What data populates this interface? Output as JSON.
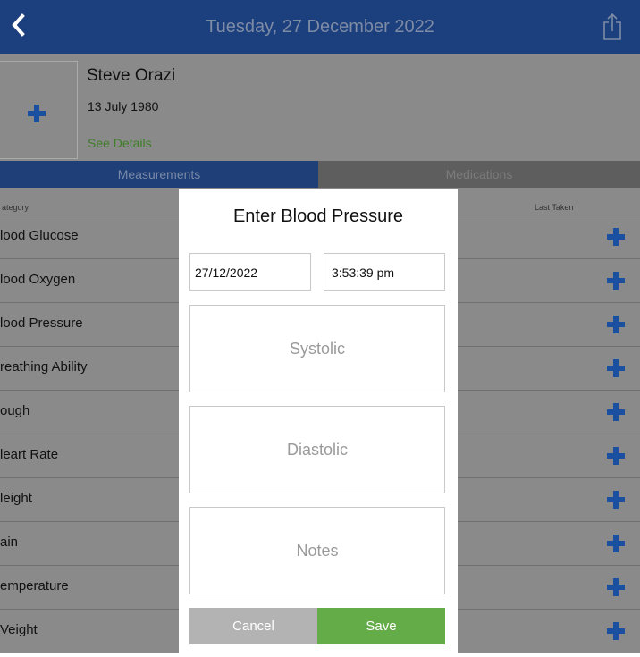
{
  "topbar": {
    "title": "Tuesday, 27 December 2022",
    "back_icon": "chevron-left-icon",
    "share_icon": "share-icon"
  },
  "patient": {
    "name": "Steve Orazi",
    "dob": "13 July 1980",
    "details_link": "See Details",
    "add_photo_icon": "plus-icon"
  },
  "tabs": [
    {
      "label": "Measurements",
      "active": true
    },
    {
      "label": "Medications",
      "active": false
    }
  ],
  "list": {
    "headers": {
      "category": "ategory",
      "last_taken": "Last Taken"
    },
    "rows": [
      {
        "label": "lood Glucose"
      },
      {
        "label": "lood Oxygen"
      },
      {
        "label": "lood Pressure"
      },
      {
        "label": "reathing Ability"
      },
      {
        "label": "ough"
      },
      {
        "label": "leart Rate"
      },
      {
        "label": "leight"
      },
      {
        "label": "ain"
      },
      {
        "label": "emperature"
      },
      {
        "label": "Veight"
      }
    ]
  },
  "modal": {
    "title": "Enter Blood Pressure",
    "date_value": "27/12/2022",
    "time_value": "3:53:39 pm",
    "systolic_placeholder": "Systolic",
    "diastolic_placeholder": "Diastolic",
    "notes_placeholder": "Notes",
    "cancel_label": "Cancel",
    "save_label": "Save"
  },
  "colors": {
    "nav_blue": "#1c3f7d",
    "dim_gray": "#8a8a8a",
    "accent_blue": "#1b4fa0",
    "save_green": "#64ac48",
    "cancel_gray": "#b3b3b3",
    "link_green": "#3e7e27"
  }
}
